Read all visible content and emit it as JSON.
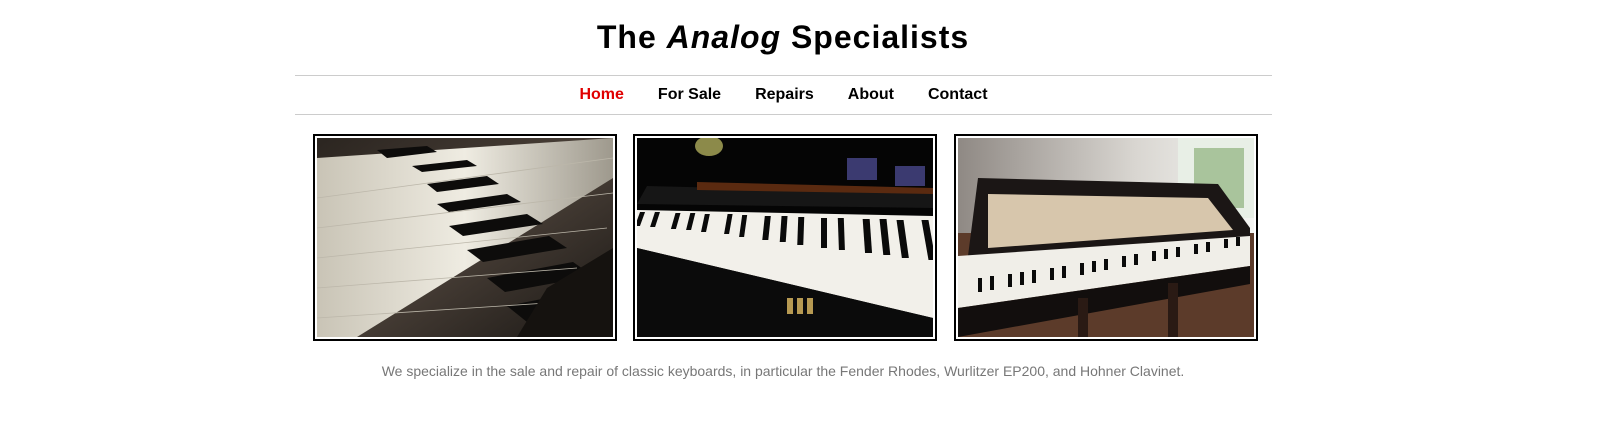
{
  "header": {
    "title_prefix": "The ",
    "title_emphasis": "Analog",
    "title_suffix": " Specialists"
  },
  "nav": {
    "items": [
      {
        "label": "Home",
        "active": true
      },
      {
        "label": "For Sale",
        "active": false
      },
      {
        "label": "Repairs",
        "active": false
      },
      {
        "label": "About",
        "active": false
      },
      {
        "label": "Contact",
        "active": false
      }
    ],
    "active_color": "#e00000"
  },
  "gallery": {
    "photos": [
      {
        "subject": "piano-keys-closeup-photo"
      },
      {
        "subject": "grand-piano-keyboard-front-photo"
      },
      {
        "subject": "steinway-grand-piano-side-photo"
      }
    ]
  },
  "main": {
    "tagline": "We specialize in the sale and repair of classic keyboards, in particular the Fender Rhodes, Wurlitzer EP200, and Hohner Clavinet."
  }
}
